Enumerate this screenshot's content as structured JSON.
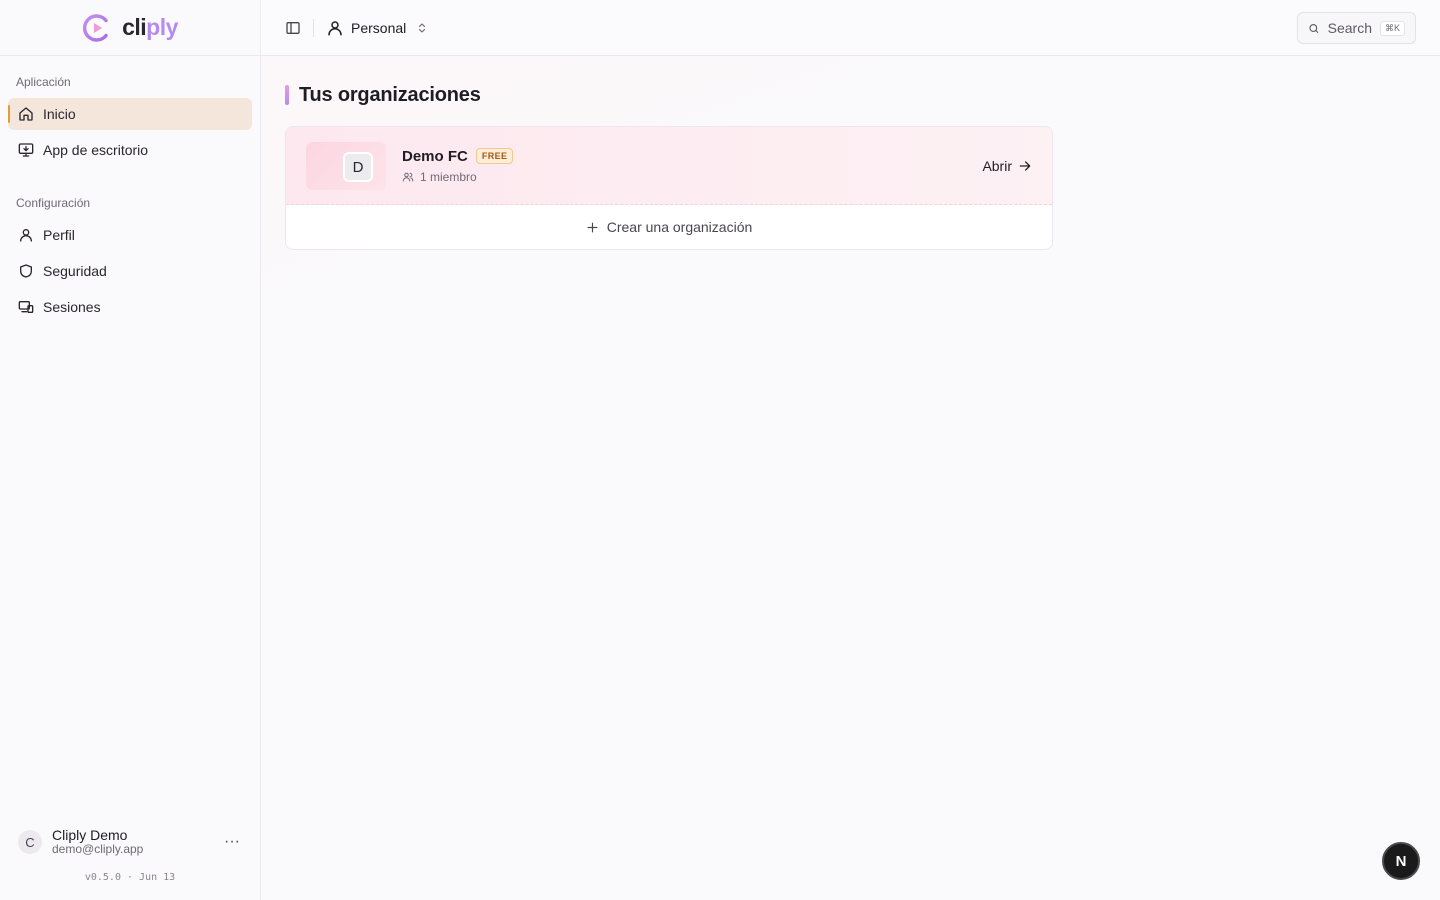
{
  "brand": {
    "name_part1": "cli",
    "name_part2": "ply",
    "logo_icon": "cliply-logo"
  },
  "sidebar": {
    "sections": [
      {
        "heading": "Aplicación",
        "items": [
          {
            "label": "Inicio",
            "icon": "home-icon",
            "active": true
          },
          {
            "label": "App de escritorio",
            "icon": "desktop-icon",
            "active": false
          }
        ]
      },
      {
        "heading": "Configuración",
        "items": [
          {
            "label": "Perfil",
            "icon": "user-icon",
            "active": false
          },
          {
            "label": "Seguridad",
            "icon": "shield-icon",
            "active": false
          },
          {
            "label": "Sesiones",
            "icon": "sessions-icon",
            "active": false
          }
        ]
      }
    ],
    "user": {
      "initial": "C",
      "name": "Cliply Demo",
      "email": "demo@cliply.app",
      "more": "···"
    },
    "version": "v0.5.0 · Jun 13"
  },
  "topbar": {
    "switcher_label": "Personal",
    "search": {
      "label": "Search",
      "shortcut": "⌘K"
    }
  },
  "main": {
    "title": "Tus organizaciones",
    "organizations": [
      {
        "initial": "D",
        "name": "Demo FC",
        "plan": "FREE",
        "members": "1 miembro",
        "open_label": "Abrir"
      }
    ],
    "create_label": "Crear una organización"
  },
  "fab_label": "N",
  "colors": {
    "accent": "#b48cf0",
    "active_bg": "#f5e6dc",
    "active_marker": "#e59b2f",
    "badge": "#fdecd6"
  }
}
